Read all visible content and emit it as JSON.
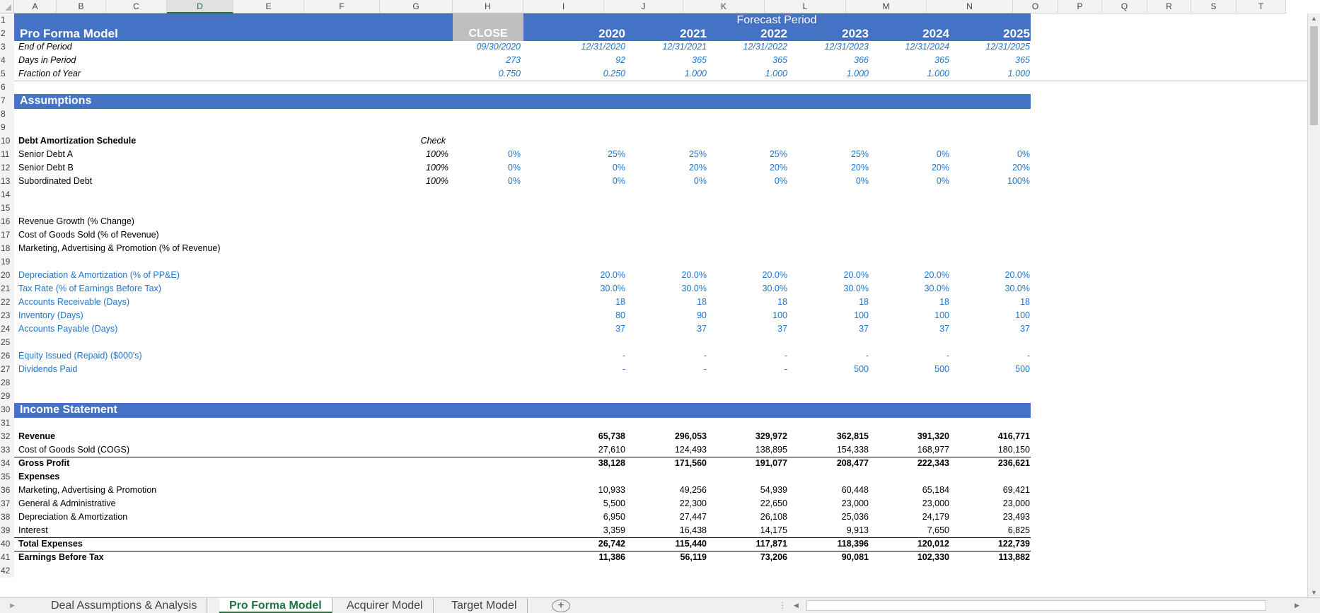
{
  "columns": [
    "A",
    "B",
    "C",
    "D",
    "E",
    "F",
    "G",
    "H",
    "I",
    "J",
    "K",
    "L",
    "M",
    "N",
    "O",
    "P",
    "Q",
    "R",
    "S",
    "T"
  ],
  "selected_column": "D",
  "header": {
    "forecast_label": "Forecast Period",
    "title": "Pro Forma Model",
    "close_label": "CLOSE",
    "years": [
      "2020",
      "2021",
      "2022",
      "2023",
      "2024",
      "2025"
    ],
    "rows": [
      {
        "label": "End of Period",
        "close": "09/30/2020",
        "values": [
          "12/31/2020",
          "12/31/2021",
          "12/31/2022",
          "12/31/2023",
          "12/31/2024",
          "12/31/2025"
        ]
      },
      {
        "label": "Days in Period",
        "close": "273",
        "values": [
          "92",
          "365",
          "365",
          "366",
          "365",
          "365"
        ]
      },
      {
        "label": "Fraction of Year",
        "close": "0.750",
        "values": [
          "0.250",
          "1.000",
          "1.000",
          "1.000",
          "1.000",
          "1.000"
        ]
      }
    ]
  },
  "assumptions": {
    "title": "Assumptions",
    "debt_schedule_label": "Debt Amortization Schedule",
    "check_label": "Check",
    "debt_rows": [
      {
        "label": "Senior Debt A",
        "check": "100%",
        "close": "0%",
        "values": [
          "25%",
          "25%",
          "25%",
          "25%",
          "0%",
          "0%"
        ]
      },
      {
        "label": "Senior Debt B",
        "check": "100%",
        "close": "0%",
        "values": [
          "0%",
          "20%",
          "20%",
          "20%",
          "20%",
          "20%"
        ]
      },
      {
        "label": "Subordinated Debt",
        "check": "100%",
        "close": "0%",
        "values": [
          "0%",
          "0%",
          "0%",
          "0%",
          "0%",
          "100%"
        ]
      }
    ],
    "growth_labels": [
      "Revenue Growth (% Change)",
      "Cost of Goods Sold (% of Revenue)",
      "Marketing, Advertising & Promotion (% of Revenue)"
    ],
    "driver_rows": [
      {
        "label": "Depreciation & Amortization (% of PP&E)",
        "values": [
          "20.0%",
          "20.0%",
          "20.0%",
          "20.0%",
          "20.0%",
          "20.0%"
        ]
      },
      {
        "label": "Tax Rate (% of Earnings Before Tax)",
        "values": [
          "30.0%",
          "30.0%",
          "30.0%",
          "30.0%",
          "30.0%",
          "30.0%"
        ]
      },
      {
        "label": "Accounts Receivable (Days)",
        "values": [
          "18",
          "18",
          "18",
          "18",
          "18",
          "18"
        ]
      },
      {
        "label": "Inventory (Days)",
        "values": [
          "80",
          "90",
          "100",
          "100",
          "100",
          "100"
        ]
      },
      {
        "label": "Accounts Payable (Days)",
        "values": [
          "37",
          "37",
          "37",
          "37",
          "37",
          "37"
        ]
      }
    ],
    "equity_rows": [
      {
        "label": "Equity Issued (Repaid) ($000's)",
        "values": [
          "-",
          "-",
          "-",
          "-",
          "-",
          "-"
        ]
      },
      {
        "label": "Dividends Paid",
        "values": [
          "-",
          "-",
          "-",
          "500",
          "500",
          "500"
        ]
      }
    ]
  },
  "income_statement": {
    "title": "Income Statement",
    "rows": [
      {
        "label": "Revenue",
        "bold": true,
        "values": [
          "65,738",
          "296,053",
          "329,972",
          "362,815",
          "391,320",
          "416,771"
        ]
      },
      {
        "label": "Cost of Goods Sold (COGS)",
        "bold": false,
        "values": [
          "27,610",
          "124,493",
          "138,895",
          "154,338",
          "168,977",
          "180,150"
        ]
      },
      {
        "label": "Gross Profit",
        "bold": true,
        "values": [
          "38,128",
          "171,560",
          "191,077",
          "208,477",
          "222,343",
          "236,621"
        ]
      },
      {
        "label": "Expenses",
        "bold": true,
        "values": [
          "",
          "",
          "",
          "",
          "",
          ""
        ]
      },
      {
        "label": "Marketing, Advertising & Promotion",
        "bold": false,
        "values": [
          "10,933",
          "49,256",
          "54,939",
          "60,448",
          "65,184",
          "69,421"
        ]
      },
      {
        "label": "General & Administrative",
        "bold": false,
        "values": [
          "5,500",
          "22,300",
          "22,650",
          "23,000",
          "23,000",
          "23,000"
        ]
      },
      {
        "label": "Depreciation & Amortization",
        "bold": false,
        "values": [
          "6,950",
          "27,447",
          "26,108",
          "25,036",
          "24,179",
          "23,493"
        ]
      },
      {
        "label": "Interest",
        "bold": false,
        "values": [
          "3,359",
          "16,438",
          "14,175",
          "9,913",
          "7,650",
          "6,825"
        ]
      },
      {
        "label": "Total Expenses",
        "bold": true,
        "values": [
          "26,742",
          "115,440",
          "117,871",
          "118,396",
          "120,012",
          "122,739"
        ]
      },
      {
        "label": "Earnings Before Tax",
        "bold": true,
        "values": [
          "11,386",
          "56,119",
          "73,206",
          "90,081",
          "102,330",
          "113,882"
        ]
      }
    ]
  },
  "sheet_tabs": [
    "Deal Assumptions & Analysis",
    "Pro Forma Model",
    "Acquirer Model",
    "Target Model"
  ],
  "active_tab": "Pro Forma Model",
  "add_sheet_label": "+",
  "colors": {
    "band": "#4472c4",
    "close_fill": "#bfbfbf",
    "input_blue": "#1f75c9",
    "tab_active": "#217346"
  }
}
